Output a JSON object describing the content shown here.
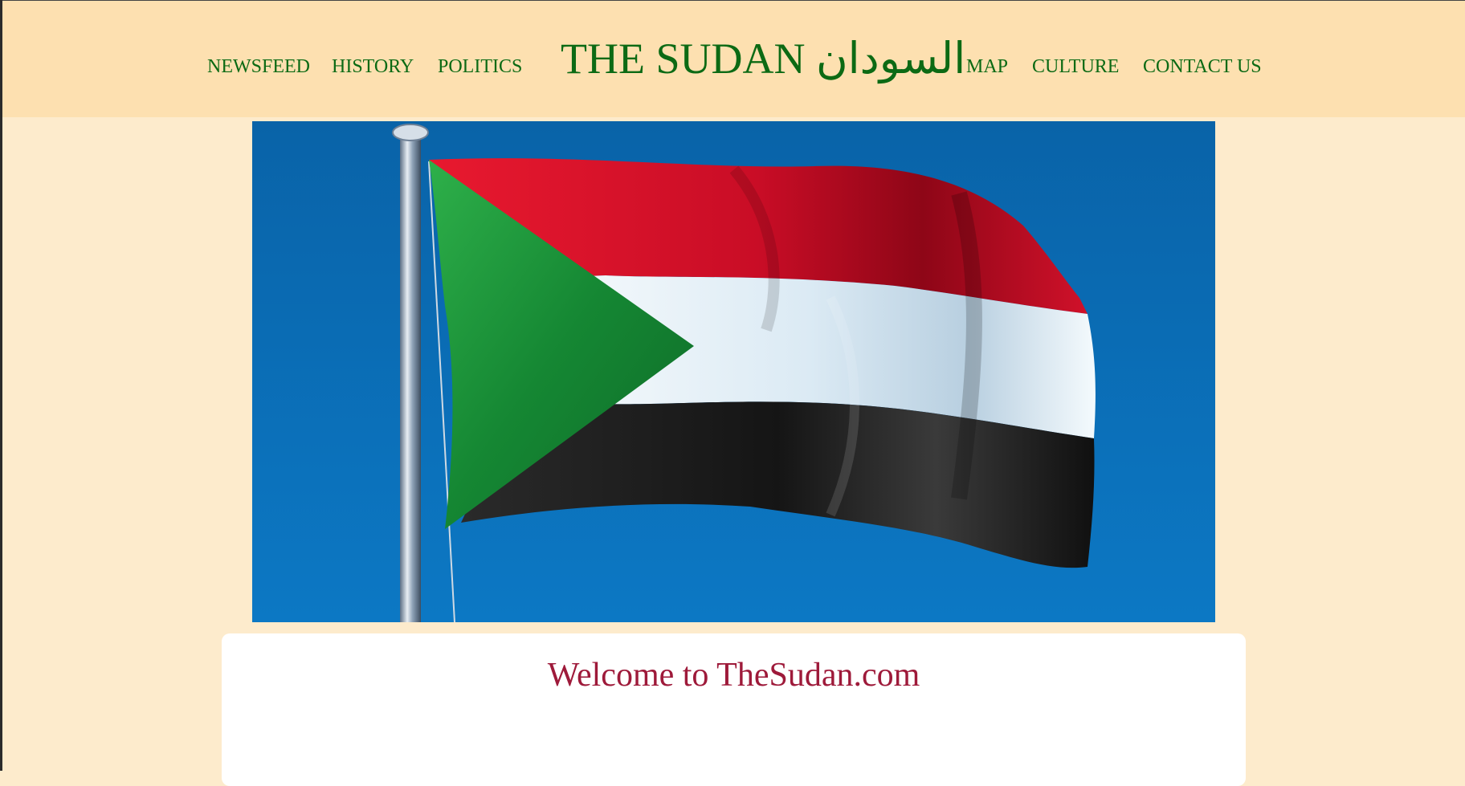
{
  "nav": {
    "left": [
      "NEWSFEED",
      "HISTORY",
      "POLITICS"
    ],
    "right": [
      "MAP",
      "CULTURE",
      "CONTACT US"
    ]
  },
  "site": {
    "title": "THE SUDAN السودان"
  },
  "hero": {
    "image_alt": "Flag of Sudan waving on a flagpole against a blue sky",
    "colors": {
      "sky": "#0a6fb8",
      "red": "#d2102a",
      "white": "#eef6fb",
      "black": "#1a1a1a",
      "green": "#1f9a3c"
    }
  },
  "welcome": {
    "heading": "Welcome to TheSudan.com"
  },
  "colors": {
    "header_bg": "#fde0b0",
    "page_bg": "#fdebcc",
    "link": "#0c6a14",
    "heading": "#9e1a3a"
  }
}
